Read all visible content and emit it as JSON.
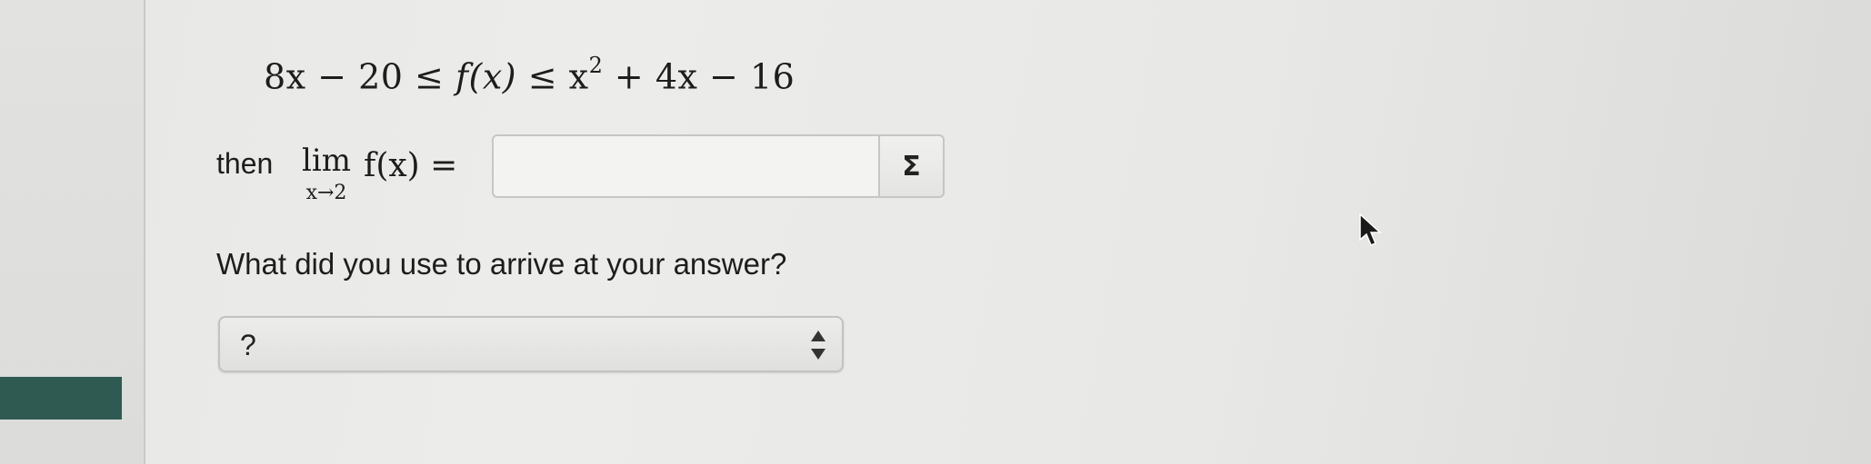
{
  "problem": {
    "inequality": {
      "left": "8x − 20 ≤ ",
      "middle": "f(x)",
      "right_pre": " ≤ x",
      "exponent": "2",
      "right_post": " + 4x − 16"
    },
    "limit": {
      "then_word": "then",
      "lim_word": "lim",
      "lim_sub": "x→2",
      "expression": "f(x) ="
    },
    "answer_input": {
      "value": "",
      "equation_button_label": "Σ"
    },
    "question": "What did you use to arrive at your answer?",
    "method_select": {
      "selected": "?"
    }
  },
  "colors": {
    "accent_bar": "#2f5a52",
    "input_border": "#c6c6c4"
  },
  "icons": {
    "equation_editor": "sigma-icon",
    "select_arrows": "up-down-arrows-icon",
    "pointer": "mouse-cursor-icon"
  }
}
